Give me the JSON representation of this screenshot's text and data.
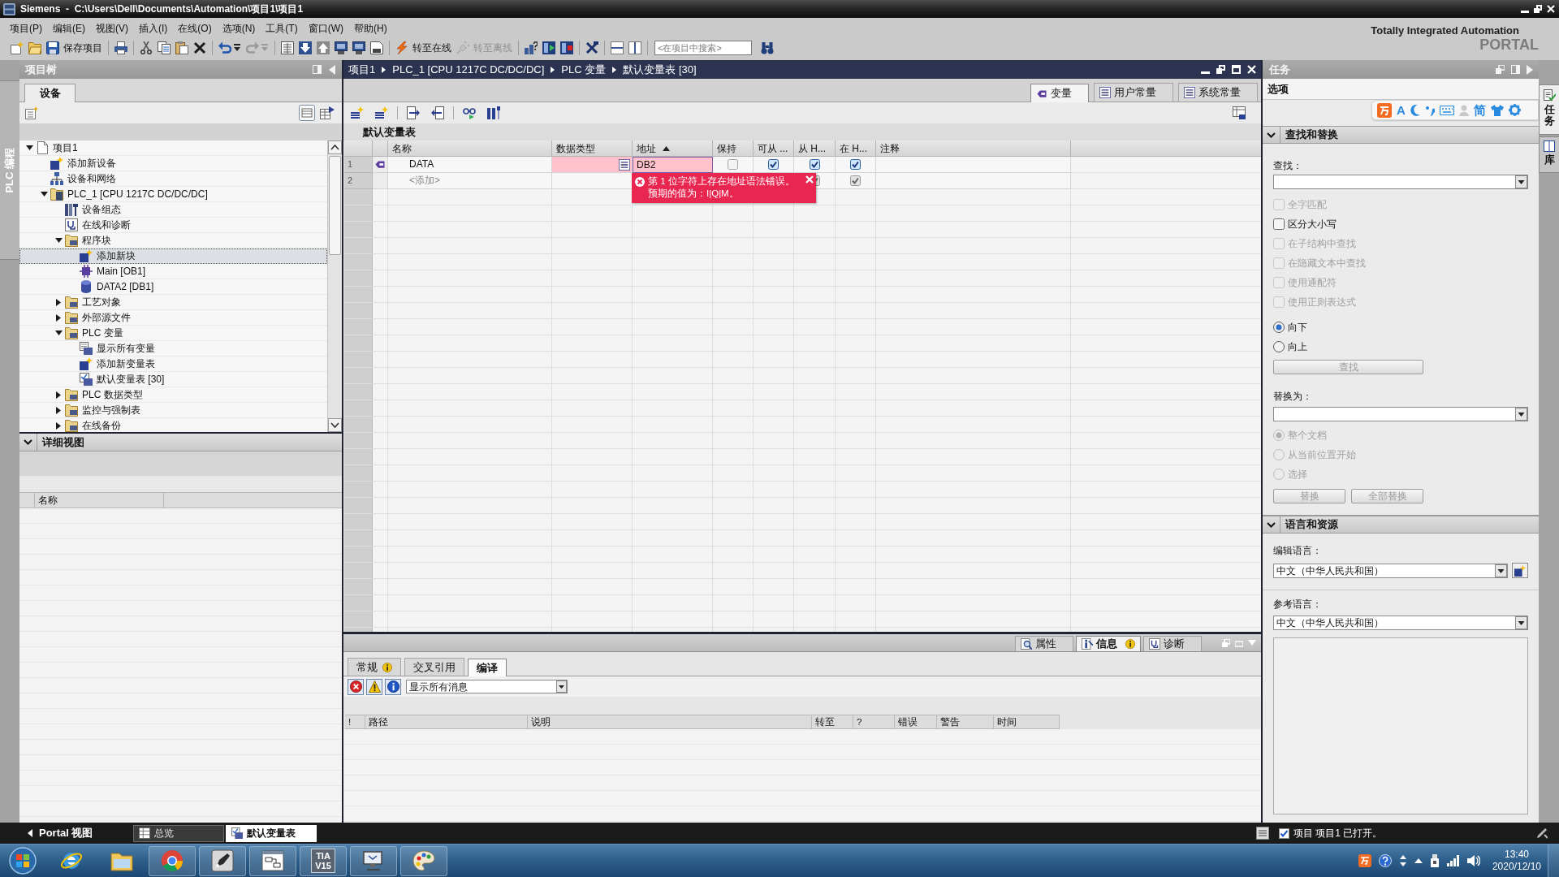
{
  "window": {
    "title": "Siemens  -  C:\\Users\\Dell\\Documents\\Automation\\项目1\\项目1"
  },
  "menu": [
    "项目(P)",
    "编辑(E)",
    "视图(V)",
    "插入(I)",
    "在线(O)",
    "选项(N)",
    "工具(T)",
    "窗口(W)",
    "帮助(H)"
  ],
  "toolbar": {
    "buttons": [
      {
        "label": "保存项目",
        "disabled": false
      },
      {
        "label": "转至在线",
        "disabled": false
      },
      {
        "label": "转至离线",
        "disabled": true
      }
    ],
    "search": {
      "placeholder": "<在项目中搜索>"
    }
  },
  "brand": {
    "line_1": "Totally Integrated Automation",
    "line_2": "PORTAL"
  },
  "left_sidebar": {
    "tabs": [
      {
        "label": "PLC 编程"
      }
    ]
  },
  "project_tree": {
    "title": "项目树",
    "tabs": [
      {
        "label": "设备",
        "selected": true
      }
    ],
    "items": [
      {
        "kind": "project",
        "label": "项目1",
        "expanded": true,
        "selected": false,
        "children": [
          {
            "kind": "add",
            "label": "添加新设备",
            "selected": false
          },
          {
            "kind": "network",
            "label": "设备和网络",
            "selected": false
          },
          {
            "kind": "device",
            "label": "PLC_1 [CPU 1217C DC/DC/DC]",
            "expanded": true,
            "selected": false,
            "children": [
              {
                "kind": "device-config",
                "label": "设备组态",
                "selected": false
              },
              {
                "kind": "diagnostics",
                "label": "在线和诊断",
                "selected": false
              },
              {
                "kind": "folder",
                "label": "程序块",
                "expanded": true,
                "selected": false,
                "children": [
                  {
                    "kind": "add",
                    "label": "添加新块",
                    "selected": true
                  },
                  {
                    "kind": "block",
                    "label": "Main [OB1]",
                    "selected": false
                  },
                  {
                    "kind": "data-block",
                    "label": "DATA2 [DB1]",
                    "selected": false
                  }
                ]
              },
              {
                "kind": "folder",
                "label": "工艺对象",
                "expanded": false,
                "selected": false
              },
              {
                "kind": "folder",
                "label": "外部源文件",
                "expanded": false,
                "selected": false
              },
              {
                "kind": "folder",
                "label": "PLC 变量",
                "expanded": true,
                "selected": false,
                "children": [
                  {
                    "kind": "tag-list",
                    "label": "显示所有变量",
                    "selected": false
                  },
                  {
                    "kind": "add",
                    "label": "添加新变量表",
                    "selected": false
                  },
                  {
                    "kind": "tag-table",
                    "label": "默认变量表 [30]",
                    "selected": false
                  }
                ]
              },
              {
                "kind": "folder",
                "label": "PLC 数据类型",
                "expanded": false,
                "selected": false
              },
              {
                "kind": "folder",
                "label": "监控与强制表",
                "expanded": false,
                "selected": false
              },
              {
                "kind": "folder",
                "label": "在线备份",
                "expanded": false,
                "selected": false
              }
            ]
          }
        ]
      }
    ]
  },
  "detail_view": {
    "title": "详细视图",
    "expanded": true,
    "columns": [
      "名称"
    ]
  },
  "editor": {
    "breadcrumb": [
      "项目1",
      "PLC_1 [CPU 1217C DC/DC/DC]",
      "PLC 变量",
      "默认变量表 [30]"
    ],
    "tabs": [
      {
        "kind": "tags",
        "label": "变量",
        "selected": true
      },
      {
        "kind": "user-constants",
        "label": "用户常量",
        "selected": false
      },
      {
        "kind": "system-constants",
        "label": "系统常量",
        "selected": false
      }
    ],
    "table": {
      "title": "默认变量表",
      "columns": [
        {
          "label": "名称",
          "sorted": false
        },
        {
          "label": "数据类型",
          "sorted": false
        },
        {
          "label": "地址",
          "sorted": true
        },
        {
          "label": "保持",
          "sorted": false
        },
        {
          "label": "可从 ...",
          "sorted": false
        },
        {
          "label": "从 H...",
          "sorted": false
        },
        {
          "label": "在 H...",
          "sorted": false
        },
        {
          "label": "注释",
          "sorted": false
        }
      ],
      "rows": [
        {
          "kind": "tag",
          "number": "1",
          "name": "DATA",
          "address": "DB2",
          "error": true,
          "retain": false,
          "hmi_accessible": true,
          "hmi_writable": true,
          "hmi_visible": true
        },
        {
          "kind": "add",
          "number": "2",
          "name": "<添加>",
          "error": false,
          "hmi_writable": true,
          "hmi_visible": true
        }
      ]
    },
    "error_tooltip": {
      "lines": [
        "第 1 位字符上存在地址语法错误。",
        "预期的值为：I|Q|M。"
      ]
    }
  },
  "inspector": {
    "tabs": [
      {
        "kind": "properties",
        "label": "属性",
        "selected": false,
        "info": false
      },
      {
        "kind": "info",
        "label": "信息",
        "selected": true,
        "info": true
      },
      {
        "kind": "diagnostics",
        "label": "诊断",
        "selected": false,
        "info": false
      }
    ],
    "subtabs": [
      {
        "label": "常规",
        "selected": false,
        "info": true
      },
      {
        "label": "交叉引用",
        "selected": false,
        "info": false
      },
      {
        "label": "编译",
        "selected": true,
        "info": false
      }
    ],
    "filters": [
      {
        "kind": "error",
        "on": true
      },
      {
        "kind": "warning",
        "on": true
      },
      {
        "kind": "info",
        "on": true
      }
    ],
    "filter_select": {
      "value": "显示所有消息"
    },
    "columns": [
      "!",
      "路径",
      "说明",
      "转至",
      "?",
      "错误",
      "警告",
      "时间"
    ]
  },
  "task_panel": {
    "title": "任务",
    "heading": "选项",
    "sections": [
      {
        "kind": "find_replace",
        "title": "查找和替换",
        "expanded": true,
        "find_label": "查找：",
        "options": [
          {
            "label": "全字匹配",
            "checked": false,
            "disabled": true
          },
          {
            "label": "区分大小写",
            "checked": false,
            "disabled": false
          },
          {
            "label": "在子结构中查找",
            "checked": false,
            "disabled": true
          },
          {
            "label": "在隐藏文本中查找",
            "checked": false,
            "disabled": true
          },
          {
            "label": "使用通配符",
            "checked": false,
            "disabled": true
          },
          {
            "label": "使用正则表达式",
            "checked": false,
            "disabled": true
          }
        ],
        "direction": [
          {
            "label": "向下",
            "selected": true,
            "disabled": false
          },
          {
            "label": "向上",
            "selected": false,
            "disabled": false
          }
        ],
        "find_button": {
          "label": "查找",
          "disabled": true
        },
        "replace_label": "替换为：",
        "scope": [
          {
            "label": "整个文档",
            "selected": true,
            "disabled": true
          },
          {
            "label": "从当前位置开始",
            "selected": false,
            "disabled": true
          },
          {
            "label": "选择",
            "selected": false,
            "disabled": true
          }
        ],
        "buttons": [
          {
            "label": "替换",
            "disabled": true
          },
          {
            "label": "全部替换",
            "disabled": true
          }
        ]
      },
      {
        "kind": "language",
        "title": "语言和资源",
        "expanded": true,
        "edit_label": "编辑语言：",
        "edit_value": "中文（中华人民共和国）",
        "reference_label": "参考语言：",
        "reference_value": "中文（中华人民共和国）"
      }
    ]
  },
  "side_tabs": [
    {
      "label": "任务",
      "selected": true
    },
    {
      "label": "库",
      "selected": false
    }
  ],
  "ime_toolbar": {
    "mode_label": "A",
    "script_label": "简"
  },
  "status_bar": {
    "portal_view": "Portal 视图",
    "tabs": [
      {
        "kind": "overview",
        "label": "总览",
        "selected": false
      },
      {
        "kind": "tag-table",
        "label": "默认变量表",
        "selected": true
      }
    ],
    "message": "项目 项目1 已打开。"
  },
  "taskbar": {
    "apps": [
      {
        "kind": "ie",
        "running": false
      },
      {
        "kind": "explorer",
        "running": false
      },
      {
        "kind": "chrome",
        "running": true
      },
      {
        "kind": "pen",
        "running": true
      },
      {
        "kind": "diagram",
        "running": true
      },
      {
        "kind": "tia",
        "running": true,
        "label_lines": [
          "TIA",
          "V15"
        ]
      },
      {
        "kind": "monitor",
        "running": true
      },
      {
        "kind": "paint",
        "running": true
      }
    ],
    "clock": {
      "time": "13:40",
      "date": "2020/12/10"
    }
  }
}
